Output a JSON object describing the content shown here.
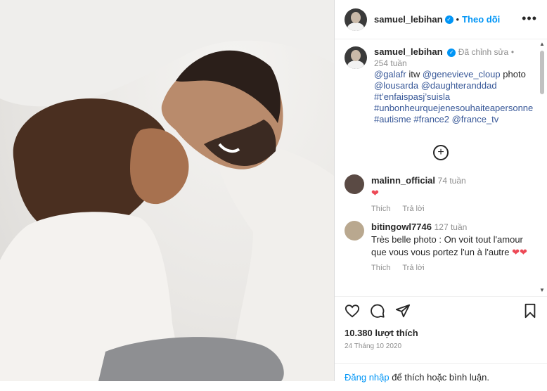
{
  "post": {
    "username": "samuel_lebihan",
    "follow_label": "Theo dõi",
    "more_label": "•••"
  },
  "caption": {
    "username": "samuel_lebihan",
    "edited": "Đã chỉnh sửa",
    "separator": "•",
    "time": "254 tuần",
    "text_prefix": "itw",
    "mentions": [
      "@galafr",
      "@genevieve_cloup",
      "@lousarda",
      "@daughteranddad"
    ],
    "photo_word": "photo",
    "hashtags": [
      "#t’enfaispasj’suisla",
      "#unbonheurquejenesouhaiteapersonne",
      "#autisme",
      "#france2"
    ],
    "tail_mention": "@france_tv"
  },
  "comments": [
    {
      "username": "malinn_official",
      "time": "74 tuần",
      "text": "❤",
      "like": "Thích",
      "reply": "Trả lời",
      "avatar_color": "#5a4a44"
    },
    {
      "username": "bitingowl7746",
      "time": "127 tuần",
      "text": "Très belle photo : On voit tout l'amour que vous vous portez l'un à l'autre",
      "emoji": "❤❤",
      "like": "Thích",
      "reply": "Trả lời",
      "avatar_color": "#b9a88f"
    }
  ],
  "likes": "10.380 lượt thích",
  "date": "24 Tháng 10 2020",
  "login": {
    "link": "Đăng nhập",
    "rest": " để thích hoặc bình luận."
  },
  "icons": [
    "heart-outline-icon",
    "comment-icon",
    "share-icon",
    "bookmark-icon",
    "plus-circle-icon",
    "verified-icon"
  ]
}
